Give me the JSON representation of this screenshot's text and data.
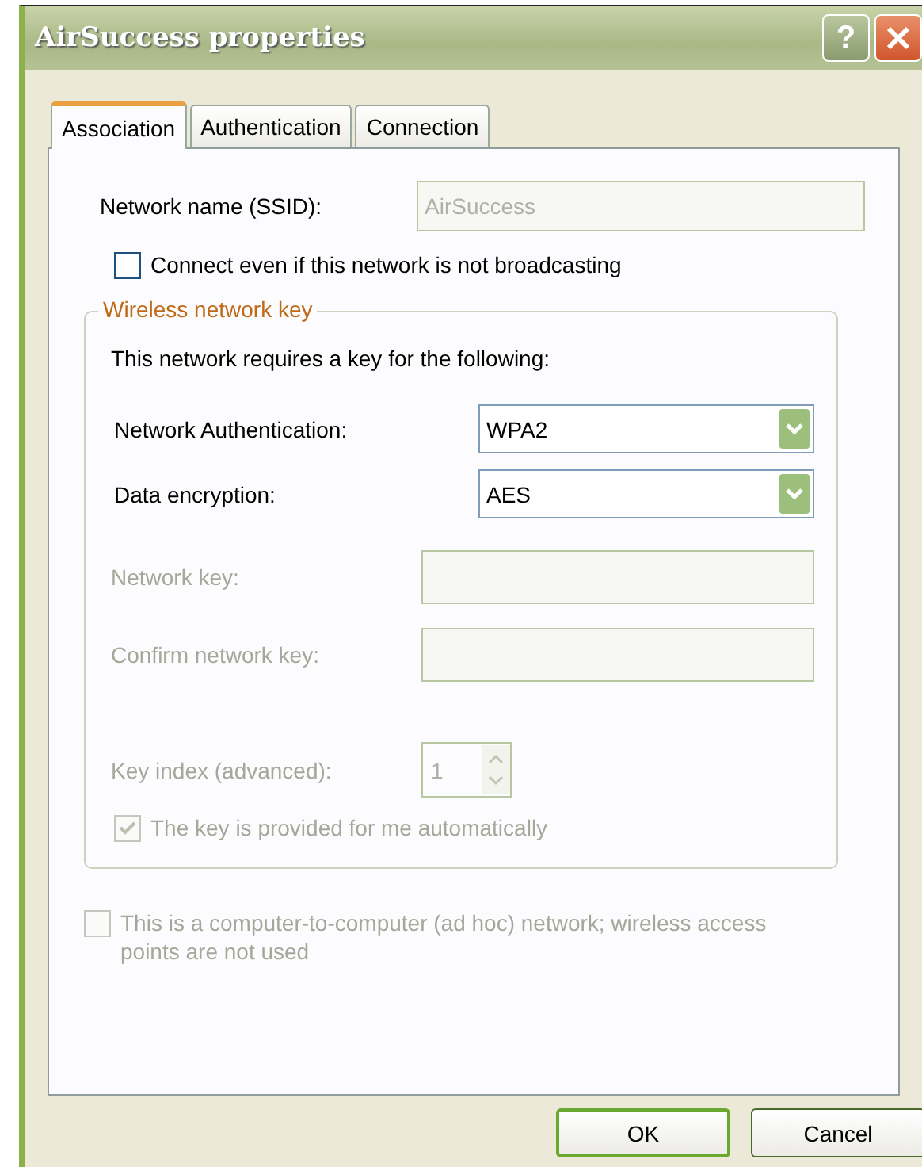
{
  "window": {
    "title": "AirSuccess properties",
    "help_button": "?"
  },
  "tabs": [
    {
      "label": "Association",
      "selected": true
    },
    {
      "label": "Authentication",
      "selected": false
    },
    {
      "label": "Connection",
      "selected": false
    }
  ],
  "ssid": {
    "label": "Network name (SSID):",
    "value": "AirSuccess",
    "disabled": true
  },
  "broadcast_checkbox": {
    "label": "Connect even if this network is not broadcasting",
    "checked": false,
    "disabled": false
  },
  "key_group": {
    "legend": "Wireless network key",
    "intro": "This network requires a key for the following:",
    "dropdowns": [
      {
        "label": "Network Authentication:",
        "value": "WPA2",
        "disabled": false
      },
      {
        "label": "Data encryption:",
        "value": "AES",
        "disabled": false
      }
    ],
    "fields": [
      {
        "label": "Network key:",
        "disabled": true
      },
      {
        "label": "Confirm network key:",
        "disabled": true
      }
    ],
    "key_index": {
      "label": "Key index (advanced):",
      "value": "1",
      "disabled": true
    },
    "auto_checkbox": {
      "label": "The key is provided for me automatically",
      "checked": true,
      "disabled": true
    }
  },
  "adhoc_checkbox": {
    "label": "This is a computer-to-computer (ad hoc) network; wireless access points are not used",
    "checked": false,
    "disabled": true
  },
  "buttons": [
    {
      "label": "OK",
      "default": true
    },
    {
      "label": "Cancel",
      "default": false
    }
  ]
}
